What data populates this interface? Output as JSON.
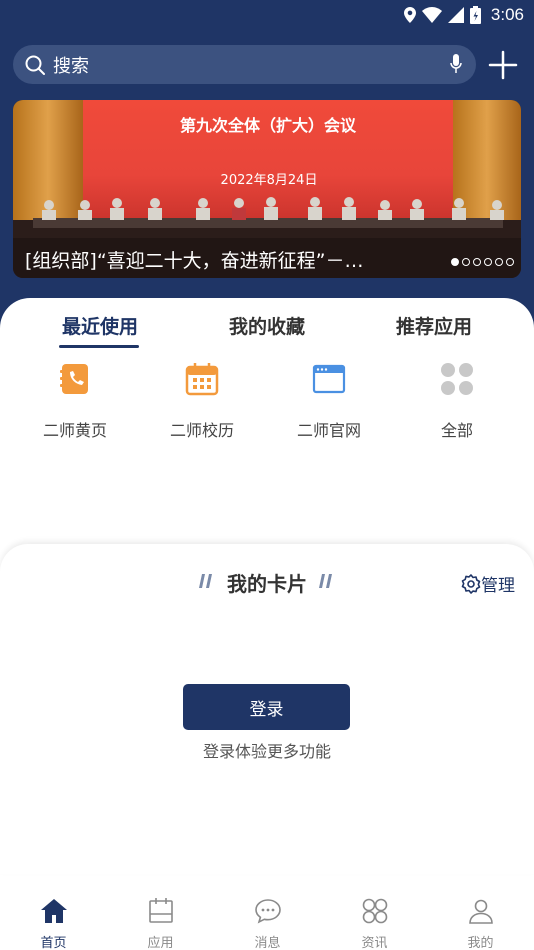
{
  "status_bar": {
    "time": "3:06"
  },
  "search": {
    "placeholder": "搜索"
  },
  "banner": {
    "caption": "[组织部]“喜迎二十大，奋进新征程”－学习贯彻",
    "poster_title": "第九次全体（扩大）会议",
    "poster_date": "2022年8月24日",
    "slide_count": 6,
    "active_slide": 1
  },
  "tabs": [
    {
      "label": "最近使用",
      "active": true
    },
    {
      "label": "我的收藏",
      "active": false
    },
    {
      "label": "推荐应用",
      "active": false
    }
  ],
  "apps": [
    {
      "label": "二师黄页",
      "icon": "phonebook-icon"
    },
    {
      "label": "二师校历",
      "icon": "calendar-icon"
    },
    {
      "label": "二师官网",
      "icon": "browser-icon"
    },
    {
      "label": "全部",
      "icon": "all-apps-icon"
    }
  ],
  "my_cards": {
    "title": "我的卡片",
    "manage_label": "管理",
    "login_label": "登录",
    "login_hint": "登录体验更多功能"
  },
  "bottom_nav": [
    {
      "label": "首页",
      "icon": "home-icon",
      "active": true
    },
    {
      "label": "应用",
      "icon": "apps-icon",
      "active": false
    },
    {
      "label": "消息",
      "icon": "message-icon",
      "active": false
    },
    {
      "label": "资讯",
      "icon": "news-icon",
      "active": false
    },
    {
      "label": "我的",
      "icon": "profile-icon",
      "active": false
    }
  ],
  "colors": {
    "primary": "#1f3566",
    "accent_orange": "#f39a3c",
    "icon_blue": "#4a90e2"
  }
}
